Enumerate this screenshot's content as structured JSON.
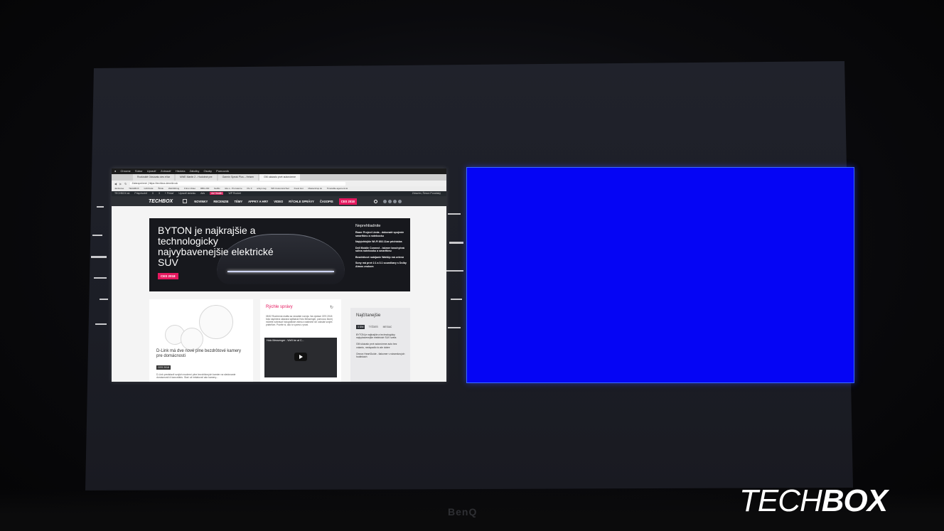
{
  "menubar": [
    "Chrome",
    "Súbor",
    "Upraviť",
    "Zobraziť",
    "História",
    "Záložky",
    "Osoby",
    "Pomocník"
  ],
  "tabs": [
    "Rozlúsktě Odsúvatu des eVar",
    "MWE Martin 2 - Hudobné pre",
    "Garmin Speak Plus – freisen",
    "GM ukázalo prvé autonómne"
  ],
  "address": {
    "url": "Zabezpečené | https://techbox.dennikn.sk"
  },
  "bookmarks": [
    "Jamboree",
    "TECHBOX",
    "GOOGLE",
    "Štítok",
    "WebSDImg",
    "Frimo Video",
    "RBG 200",
    "Netflix",
    "lido.s - Pro laterne",
    "Pio 3",
    "artsyn tag",
    "WP-CustomizeTool",
    "Kvest Hot",
    "Mastershop.sk",
    "Timetable.agement.sk"
  ],
  "wpbar": {
    "items": [
      "TECHBOX.sk",
      "Prispôsobiť",
      "0",
      "3",
      "+ Pridať",
      "Upraviť stránku",
      "Ads",
      "Ad Health",
      "WP Rocket"
    ],
    "highlight_index": 7,
    "greeting": "Zdravím, Šimon Porubský"
  },
  "site": {
    "logo": "TECHBOX",
    "nav": [
      "NOVINKY",
      "RECENZIE",
      "TÉMY",
      "APPKY A HRY",
      "VIDEO",
      "RÝCHLE SPRÁVY",
      "ČASOPIS",
      "CES 2018"
    ],
    "hero": {
      "title": "BYTON je najkrajšie a technologicky najvybavenejšie elektrické SUV",
      "badge": "CES 2018",
      "side_heading": "Neprehliadnite",
      "side_items": [
        "Razer Project Linda - dokonalé spojenie smartfónu a notebooku",
        "Najrýchlejšie Wi-Fi 802.11ax prichádza",
        "Dell Mobile Connect - takmer bezchybná súhra notebooku a smartfónu",
        "Bezdrôtové nabíjanie WattUp má zelenú",
        "Sony má prvé 2.1 a 3.1 soundbary s Dolby Atmos zvukom"
      ]
    },
    "card1": {
      "title": "D-Link má dve nové plne bezdrôtové kamery pre domácnosti",
      "badge": "CES 2018",
      "desc": "D-Link predstavil svojich moderní plne bezdrôtových kamier na sledovanie domácnosti či kanceláriu. Stač už inštalovať ako kamery..."
    },
    "card2": {
      "title": "Rýchle správy",
      "desc": "08:52 Rozšírená realita sa neustále rozvíja. Na výstave CES 2018 bola naplnená ukázaná aplikácia Holo Messenger, pomocou ktorej môžete nahrávať holografické videá a následne ich odoslať svojim priateľom. Pozrite si, ako to vyzerá v praxi.",
      "video_title": "Holo Messenger - We'll be at C..."
    },
    "card3": {
      "title": "Najčítanejšie",
      "tabs": [
        "3 DNI",
        "TÝŽDEŇ",
        "MESIAC"
      ],
      "items": [
        "BYTON je najkrajšie a technologicky najvybavenejšie elektrické SUV sveta",
        "GM ukázalo prvé autonómne auto bez volantu, nedopadlo to ale dobre",
        "Omron HeartGuide - tlakomer v náramkových hodinkách"
      ]
    }
  },
  "brand": {
    "benq": "BenQ",
    "watermark_light": "TECH",
    "watermark_bold": "BOX"
  },
  "colors": {
    "accent": "#e5195f",
    "blue_window": "#0505f5",
    "nav_bg": "#2d3035"
  }
}
